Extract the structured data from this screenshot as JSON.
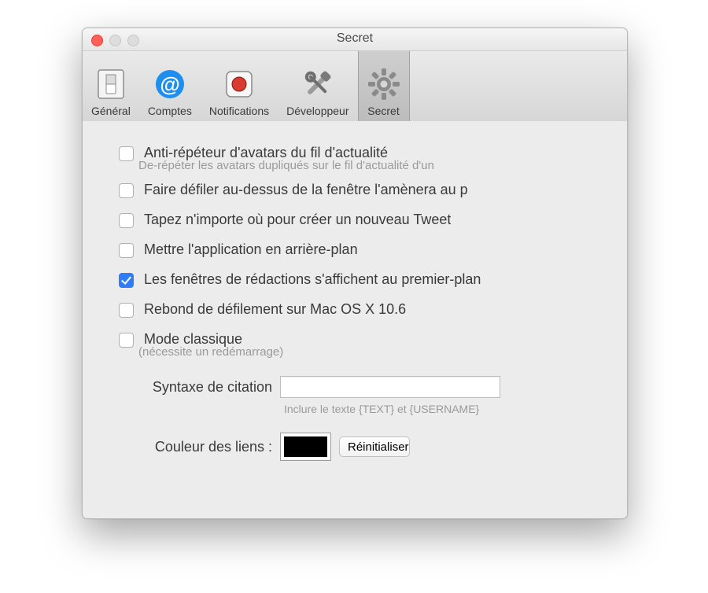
{
  "window": {
    "title": "Secret"
  },
  "tabs": [
    {
      "label": "Général"
    },
    {
      "label": "Comptes"
    },
    {
      "label": "Notifications"
    },
    {
      "label": "Développeur"
    },
    {
      "label": "Secret"
    }
  ],
  "options": {
    "anti_repeater": {
      "label": "Anti-répéteur d'avatars du fil d'actualité",
      "sub": "De-répéter les avatars dupliqués sur le fil d'actualité d'un"
    },
    "scroll_above": "Faire défiler au-dessus de la fenêtre l'amènera au p",
    "type_anywhere": "Tapez n'importe où pour créer un nouveau Tweet",
    "background": "Mettre l'application en arrière-plan",
    "compose_fg": "Les fenêtres de rédactions s'affichent au premier-plan",
    "bounce": "Rebond de défilement sur Mac OS X 10.6",
    "classic": {
      "label": "Mode classique",
      "sub": "(nécessite un redémarrage)"
    }
  },
  "quote": {
    "label": "Syntaxe de citation",
    "value": "",
    "hint": "Inclure le texte {TEXT} et {USERNAME}"
  },
  "linkcolor": {
    "label": "Couleur des liens :",
    "hex": "#000000",
    "reset": "Réinitialiser"
  }
}
